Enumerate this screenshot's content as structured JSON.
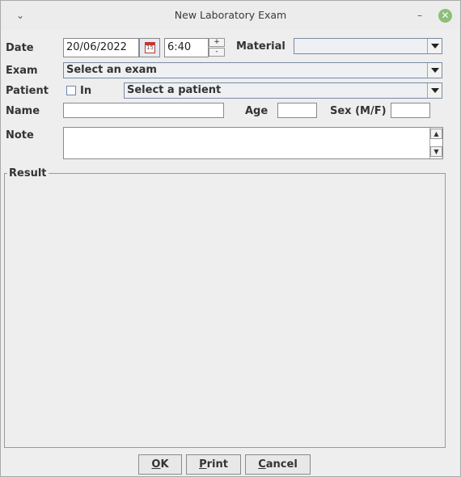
{
  "window": {
    "title": "New Laboratory Exam",
    "menu_glyph": "⌄",
    "minimize_glyph": "–",
    "close_glyph": "✕"
  },
  "form": {
    "date_label": "Date",
    "date_value": "20/06/2022",
    "calendar_day": "15",
    "time_value": "6:40",
    "time_up": "+",
    "time_down": "-",
    "material_label": "Material",
    "material_value": "",
    "exam_label": "Exam",
    "exam_value": "Select an exam",
    "patient_label": "Patient",
    "in_label": "In",
    "in_checked": false,
    "patient_value": "Select a patient",
    "name_label": "Name",
    "name_value": "",
    "age_label": "Age",
    "age_value": "",
    "sex_label": "Sex (M/F)",
    "sex_value": "",
    "note_label": "Note",
    "note_value": "",
    "result_label": "Result"
  },
  "buttons": {
    "ok": {
      "mnemonic": "O",
      "rest": "K"
    },
    "print": {
      "mnemonic": "P",
      "rest": "rint"
    },
    "cancel": {
      "mnemonic": "C",
      "rest": "ancel"
    }
  }
}
